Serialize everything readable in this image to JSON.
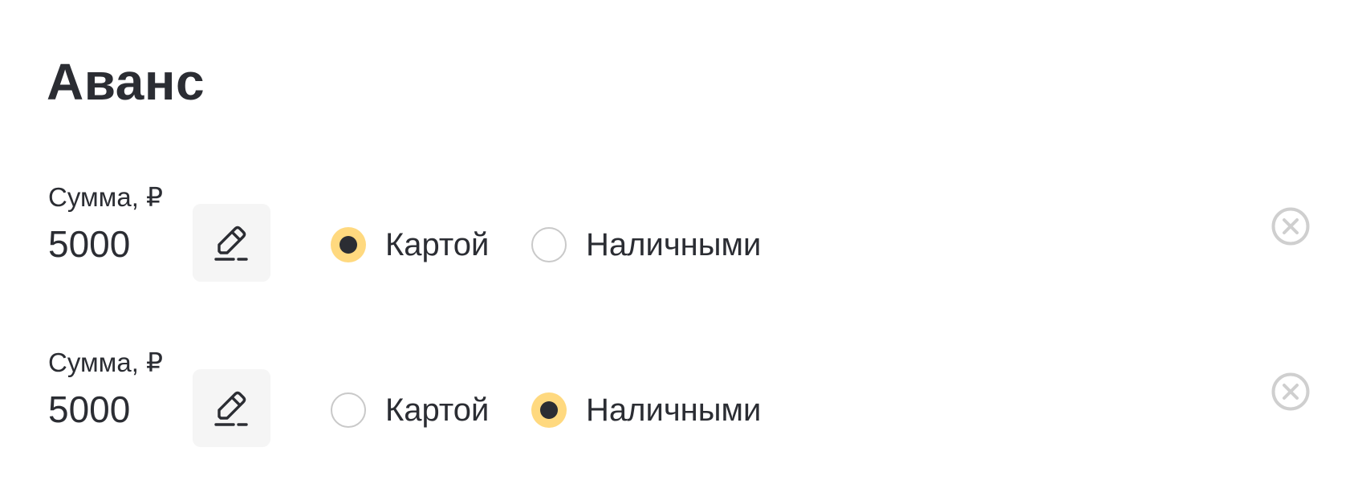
{
  "page": {
    "title": "Аванс"
  },
  "advances": [
    {
      "amount_label": "Сумма, ₽",
      "amount_value": "5000",
      "payment_options": [
        {
          "label": "Картой",
          "selected": true
        },
        {
          "label": "Наличными",
          "selected": false
        }
      ]
    },
    {
      "amount_label": "Сумма, ₽",
      "amount_value": "5000",
      "payment_options": [
        {
          "label": "Картой",
          "selected": false
        },
        {
          "label": "Наличными",
          "selected": true
        }
      ]
    }
  ],
  "colors": {
    "text": "#2b2d33",
    "radio_selected_fill": "#ffd97f",
    "radio_unselected_border": "#c9c9c9",
    "edit_button_bg": "#f5f5f5",
    "remove_icon": "#cfcfcf"
  },
  "icons": {
    "edit": "pencil-icon",
    "remove": "close-circle-icon"
  }
}
